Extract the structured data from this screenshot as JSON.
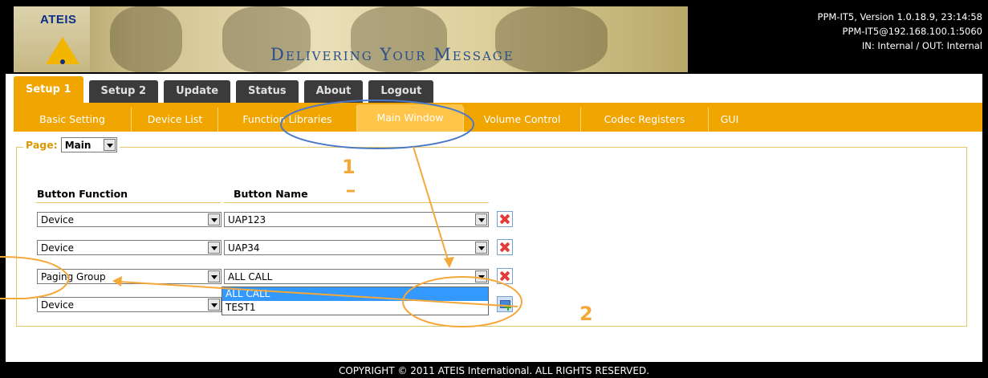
{
  "header": {
    "logo": "ATEIS",
    "slogan": "Delivering Your Message",
    "info_line1": "PPM-IT5, Version 1.0.18.9, 23:14:58",
    "info_line2": "PPM-IT5@192.168.100.1:5060",
    "info_line3": "IN: Internal / OUT: Internal"
  },
  "main_tabs": [
    "Setup 1",
    "Setup 2",
    "Update",
    "Status",
    "About",
    "Logout"
  ],
  "sub_tabs": [
    "Basic Setting",
    "Device List",
    "Function Libraries",
    "Main Window",
    "Volume Control",
    "Codec Registers",
    "GUI"
  ],
  "page": {
    "label": "Page:",
    "value": "Main"
  },
  "columns": {
    "function": "Button Function",
    "name": "Button Name"
  },
  "rows": [
    {
      "function": "Device",
      "name": "UAP123"
    },
    {
      "function": "Device",
      "name": "UAP34"
    },
    {
      "function": "Paging Group",
      "name": "ALL CALL"
    },
    {
      "function": "Device",
      "name": ""
    }
  ],
  "dropdown_options": [
    "ALL CALL",
    "TEST1"
  ],
  "annotations": [
    "1",
    "2"
  ],
  "footer": "COPYRIGHT © 2011 ATEIS International. ALL RIGHTS RESERVED.",
  "colors": {
    "accent": "#f0a500",
    "annotation": "#f5a83a",
    "highlight": "#3399ff",
    "ellipse_blue": "#4a78c8"
  }
}
